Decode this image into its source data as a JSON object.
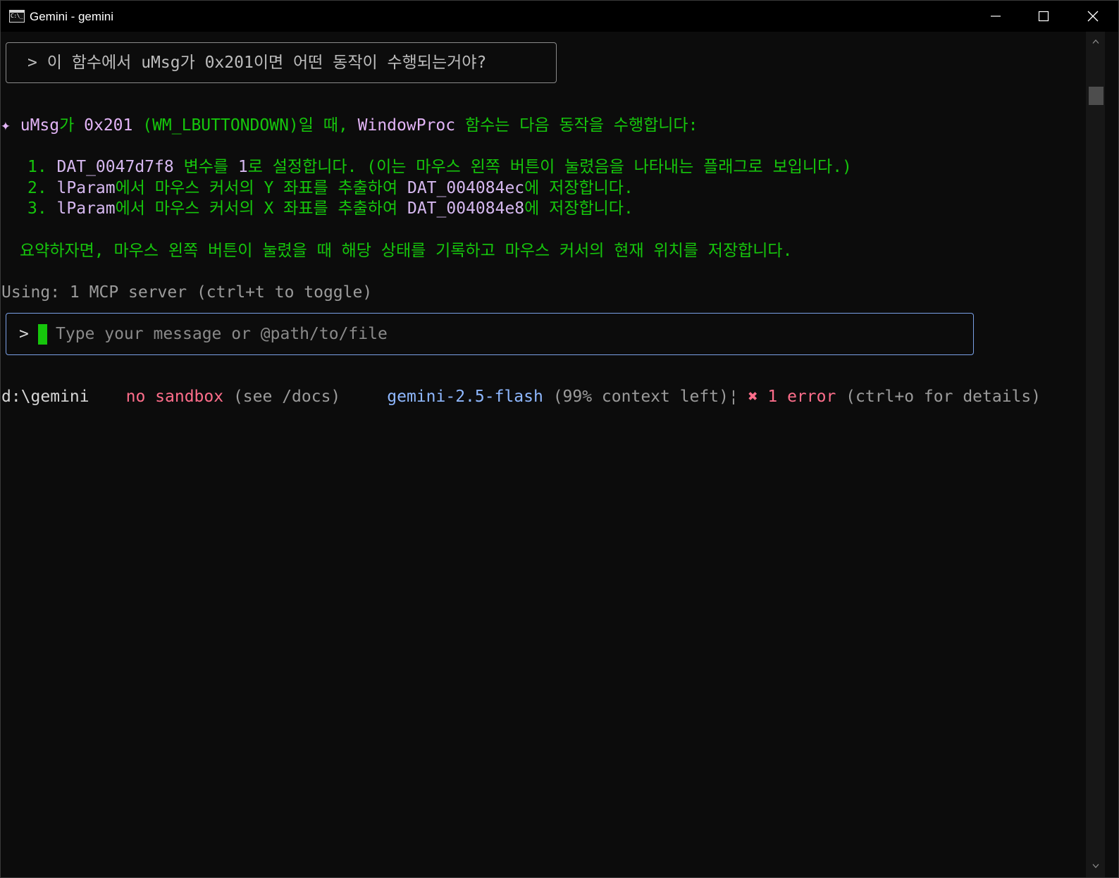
{
  "window": {
    "title": "Gemini - gemini",
    "icon_label": "C:\\_",
    "colors": {
      "background": "#0c0c0c",
      "titlebar": "#000000"
    }
  },
  "user_prompt": "> 이 함수에서 uMsg가 0x201이면 어떤 동작이 수행되는거야?",
  "response": {
    "intro": {
      "star": "✦",
      "umsg": "uMsg",
      "ga": "가 ",
      "hex": "0x201",
      "wm": " (WM_LBUTTONDOWN)일 때, ",
      "proc": "WindowProc",
      "tail": " 함수는 다음 동작을 수행합니다:"
    },
    "items": [
      {
        "num": "1. ",
        "var": "DAT_0047d7f8",
        "mid": " 변수를 ",
        "val": "1",
        "tail": "로 설정합니다. (이는 마우스 왼쪽 버튼이 눌렸음을 나타내는 플래그로 보입니다.)"
      },
      {
        "num": "2. ",
        "param": "lParam",
        "mid": "에서 마우스 커서의 Y 좌표를 추출하여 ",
        "var": "DAT_004084ec",
        "tail": "에 저장합니다."
      },
      {
        "num": "3. ",
        "param": "lParam",
        "mid": "에서 마우스 커서의 X 좌표를 추출하여 ",
        "var": "DAT_004084e8",
        "tail": "에 저장합니다."
      }
    ],
    "summary": "요약하자면, 마우스 왼쪽 버튼이 눌렸을 때 해당 상태를 기록하고 마우스 커서의 현재 위치를 저장합니다."
  },
  "mcp_status": "Using: 1 MCP server (ctrl+t to toggle)",
  "input": {
    "chevron": ">",
    "placeholder": "Type your message or @path/to/file"
  },
  "footer": {
    "path": "d:\\gemini",
    "sandbox": "no sandbox",
    "sandbox_hint": " (see /docs)",
    "model": "gemini-2.5-flash",
    "context": " (99% context left)",
    "separator": "¦",
    "error_icon": "✖",
    "error_text": " 1 error",
    "error_hint": " (ctrl+o for details)"
  },
  "icons": {
    "minimize": "minimize-icon",
    "maximize": "maximize-icon",
    "close": "close-icon",
    "scroll_up": "arrow-up-icon",
    "scroll_down": "arrow-down-icon"
  }
}
